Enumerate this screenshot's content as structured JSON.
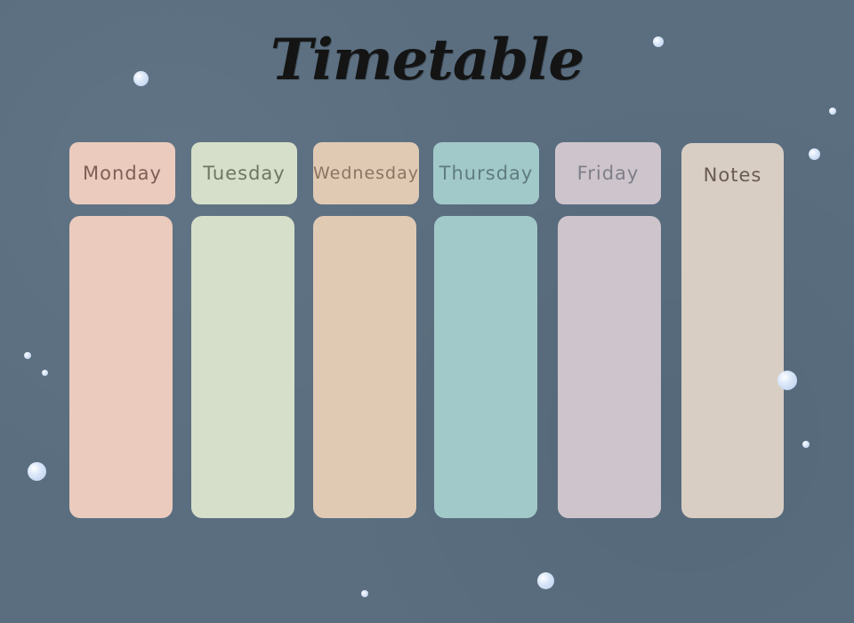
{
  "title": "Timetable",
  "days": [
    {
      "label": "Monday",
      "color": "#ebcbbd",
      "text_color": "#7d5f56"
    },
    {
      "label": "Tuesday",
      "color": "#d6dfc9",
      "text_color": "#6c7764"
    },
    {
      "label": "Wednesday",
      "color": "#e0cab4",
      "text_color": "#8b7462"
    },
    {
      "label": "Thursday",
      "color": "#a2c9ca",
      "text_color": "#5f7c7d"
    },
    {
      "label": "Friday",
      "color": "#cec4cb",
      "text_color": "#7f7f8a"
    }
  ],
  "notes": {
    "label": "Notes",
    "color": "#d8cec4",
    "text_color": "#6a5b52"
  },
  "background_color": "#5a6e80",
  "decoration": "bubble-dots"
}
